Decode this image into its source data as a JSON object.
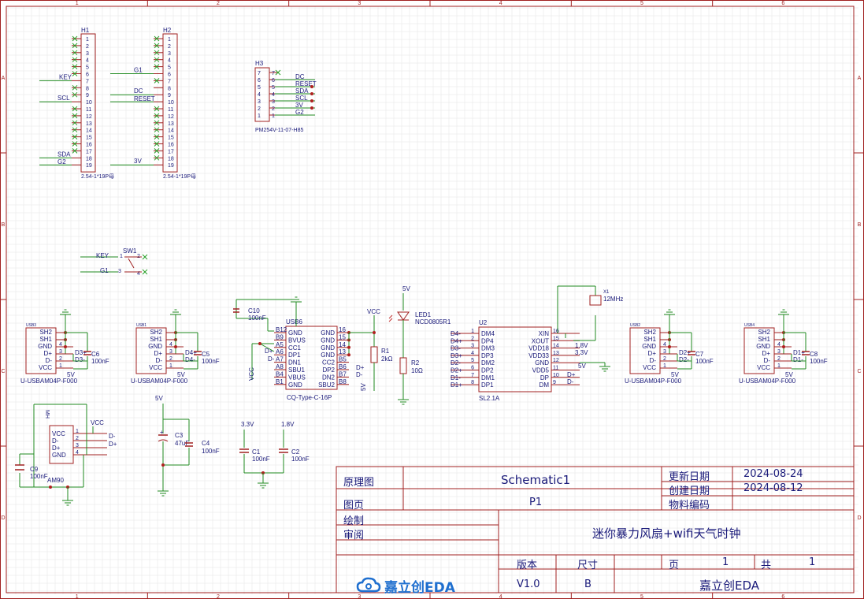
{
  "sheet": {
    "frame_columns": [
      "1",
      "2",
      "3",
      "4",
      "5",
      "6"
    ],
    "frame_rows": [
      "A",
      "B",
      "C",
      "D"
    ]
  },
  "title_block": {
    "schematic_label": "原理图",
    "schematic_name": "Schematic1",
    "page_label": "图页",
    "page_value": "P1",
    "drawn_label": "绘制",
    "review_label": "审阅",
    "updated_label": "更新日期",
    "updated_value": "2024-08-24",
    "created_label": "创建日期",
    "created_value": "2024-08-12",
    "part_code_label": "物料编码",
    "project_title": "迷你暴力风扇+wifi天气时钟",
    "version_label": "版本",
    "version_value": "V1.0",
    "size_label": "尺寸",
    "size_value": "B",
    "page_num_label": "页",
    "page_num_value": "1",
    "total_label": "共",
    "total_value": "1",
    "company": "嘉立创EDA",
    "logo_text": "嘉立创EDA"
  },
  "components": {
    "H1": {
      "ref": "H1",
      "footprint": "2.54-1*19P母",
      "pins": [
        "1",
        "2",
        "3",
        "4",
        "5",
        "6",
        "7",
        "8",
        "9",
        "10",
        "11",
        "12",
        "13",
        "14",
        "15",
        "16",
        "17",
        "18",
        "19"
      ],
      "nets": {
        "KEY": "KEY",
        "SCL": "SCL",
        "SDA": "SDA",
        "G2": "G2"
      }
    },
    "H2": {
      "ref": "H2",
      "footprint": "2.54-1*19P母",
      "pins": [
        "1",
        "2",
        "3",
        "4",
        "5",
        "6",
        "7",
        "8",
        "9",
        "10",
        "11",
        "12",
        "13",
        "14",
        "15",
        "16",
        "17",
        "18",
        "19"
      ],
      "nets": {
        "G1": "G1",
        "DC": "DC",
        "RESET": "RESET",
        "V3": "3V"
      }
    },
    "H3": {
      "ref": "H3",
      "footprint": "PM254V-11-07-H85",
      "pins": [
        "7",
        "6",
        "5",
        "4",
        "3",
        "2",
        "1"
      ],
      "nets": [
        "DC",
        "RESET",
        "SDA",
        "SCL",
        "3V",
        "G2"
      ]
    },
    "SW1": {
      "ref": "SW1",
      "nets": [
        "KEY",
        "G1"
      ],
      "pins": [
        "1",
        "2",
        "3",
        "4"
      ]
    },
    "USB3": {
      "ref": "USB3",
      "pins": [
        "SH2",
        "SH1",
        "GND",
        "D+",
        "D-",
        "VCC"
      ],
      "pin_nums": [
        "4",
        "3",
        "2",
        "1"
      ],
      "nets": [
        "D3+",
        "D3-",
        "5V"
      ],
      "part": "U-USBAM04P-F000",
      "cap_ref": "C6",
      "cap_val": "100nF"
    },
    "USB1": {
      "ref": "USB1",
      "pins": [
        "SH2",
        "SH1",
        "GND",
        "D+",
        "D-",
        "VCC"
      ],
      "pin_nums": [
        "4",
        "3",
        "2",
        "1"
      ],
      "nets": [
        "D4+",
        "D4-",
        "5V"
      ],
      "part": "U-USBAM04P-F000",
      "cap_ref": "C5",
      "cap_val": "100nF"
    },
    "USB6": {
      "ref": "USB6",
      "part": "CQ-Type-C-16P",
      "left_pins": [
        "GND",
        "BVUS",
        "CC1",
        "DP1",
        "DN1",
        "SBU1",
        "VBUS",
        "GND"
      ],
      "left_nums": [
        "B12",
        "B9",
        "A5",
        "A6",
        "A7",
        "A8",
        "B4",
        "B1"
      ],
      "right_pins": [
        "GND",
        "GND",
        "GND",
        "GND",
        "CC2",
        "DP2",
        "DN2",
        "SBU2"
      ],
      "right_nums": [
        "16",
        "15",
        "14",
        "13",
        "B5",
        "B6",
        "B7",
        "B8"
      ],
      "nets": [
        "D+",
        "D-",
        "VCC",
        "D+",
        "D-"
      ],
      "cap_ref": "C10",
      "cap_val": "100nF"
    },
    "R1": {
      "ref": "R1",
      "value": "2kΩ",
      "net": "VCC"
    },
    "LED1": {
      "ref": "LED1",
      "part": "NCD0805R1",
      "net": "5V"
    },
    "R2": {
      "ref": "R2",
      "value": "10Ω",
      "net": "5V"
    },
    "U2": {
      "ref": "U2",
      "part": "SL2.1A",
      "left_pins": [
        "DM4",
        "DP4",
        "DM3",
        "DP3",
        "DM2",
        "DP2",
        "DM1",
        "DP1"
      ],
      "left_nums": [
        "1",
        "2",
        "3",
        "4",
        "5",
        "6",
        "7",
        "8"
      ],
      "left_nets": [
        "D4-",
        "D4+",
        "D3-",
        "D3+",
        "D2-",
        "D2+",
        "D1-",
        "D1+"
      ],
      "right_pins": [
        "XIN",
        "XOUT",
        "VDD18",
        "VDD33",
        "GND",
        "VDD5",
        "DP",
        "DM"
      ],
      "right_nums": [
        "16",
        "15",
        "14",
        "13",
        "12",
        "11",
        "10",
        "9"
      ],
      "right_nets": [
        "1.8V",
        "3.3V",
        "5V",
        "D+",
        "D-"
      ]
    },
    "X1": {
      "ref": "X1",
      "value": "12MHz"
    },
    "USB2": {
      "ref": "USB2",
      "pins": [
        "SH2",
        "SH1",
        "GND",
        "D+",
        "D-",
        "VCC"
      ],
      "pin_nums": [
        "4",
        "3",
        "2",
        "1"
      ],
      "nets": [
        "D2+",
        "D2-",
        "5V"
      ],
      "part": "U-USBAM04P-F000",
      "cap_ref": "C7",
      "cap_val": "100nF"
    },
    "USB4": {
      "ref": "USB4",
      "pins": [
        "SH2",
        "SH1",
        "GND",
        "D+",
        "D-",
        "VCC"
      ],
      "pin_nums": [
        "4",
        "3",
        "2",
        "1"
      ],
      "nets": [
        "D1+",
        "D1-",
        "5V"
      ],
      "part": "U-USBAM04P-F000",
      "cap_ref": "C8",
      "cap_val": "100nF"
    },
    "USB5": {
      "ref": "MH",
      "pins": [
        "VCC",
        "D-",
        "D+",
        "GND"
      ],
      "pin_nums": [
        "1",
        "2",
        "3",
        "4"
      ],
      "nets": [
        "VCC",
        "D-",
        "D+"
      ],
      "cap_ref": "C9",
      "cap_val": "100nF",
      "part": "AM90"
    },
    "C3": {
      "ref": "C3",
      "value": "47uF",
      "net": "5V"
    },
    "C4": {
      "ref": "C4",
      "value": "100nF"
    },
    "C1": {
      "ref": "C1",
      "value": "100nF",
      "net": "3.3V"
    },
    "C2": {
      "ref": "C2",
      "value": "100nF",
      "net": "1.8V"
    }
  },
  "colors": {
    "frame": "#a02020",
    "grid": "#e4e4e4",
    "wire": "#1f8a1f",
    "body": "#a02020",
    "text": "#1a1a7a",
    "noconn": "#2aa02a",
    "pin": "#a02020"
  }
}
